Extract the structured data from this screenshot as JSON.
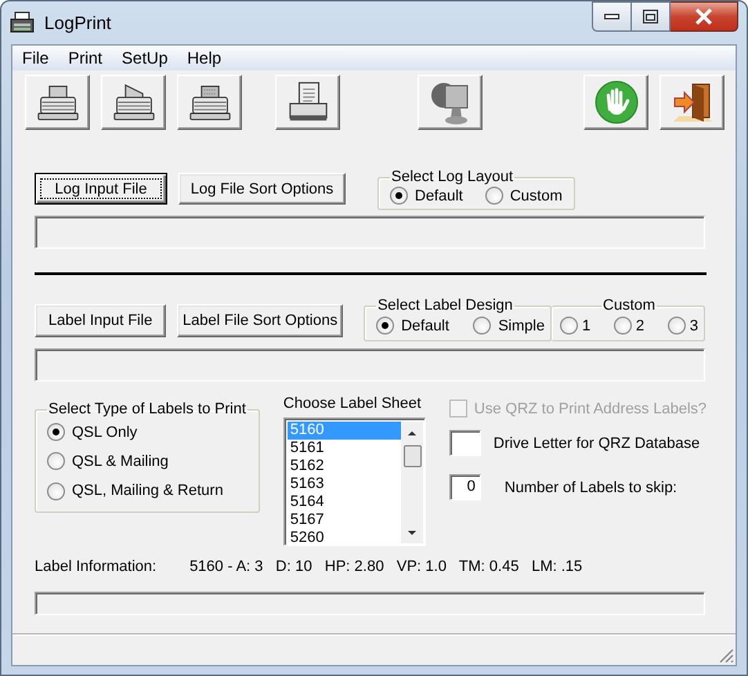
{
  "window": {
    "title": "LogPrint"
  },
  "menu": [
    "File",
    "Print",
    "SetUp",
    "Help"
  ],
  "log_section": {
    "buttons": [
      {
        "label": "Log Input File",
        "focused": true
      },
      {
        "label": "Log File Sort Options",
        "focused": false
      }
    ],
    "layout": {
      "title": "Select Log Layout",
      "options": [
        {
          "label": "Default",
          "selected": true
        },
        {
          "label": "Custom",
          "selected": false
        }
      ]
    }
  },
  "label_section": {
    "buttons": [
      {
        "label": "Label Input File",
        "focused": false
      },
      {
        "label": "Label File Sort Options",
        "focused": false
      }
    ],
    "design": {
      "title": "Select Label Design",
      "options": [
        {
          "label": "Default",
          "selected": true
        },
        {
          "label": "Simple",
          "selected": false
        }
      ]
    },
    "custom": {
      "title": "Custom",
      "options": [
        {
          "label": "1",
          "selected": false
        },
        {
          "label": "2",
          "selected": false
        },
        {
          "label": "3",
          "selected": false
        }
      ]
    }
  },
  "label_type": {
    "title": "Select Type of Labels to Print",
    "options": [
      {
        "label": "QSL Only",
        "selected": true
      },
      {
        "label": "QSL & Mailing",
        "selected": false
      },
      {
        "label": "QSL, Mailing & Return",
        "selected": false
      }
    ]
  },
  "label_sheet": {
    "title": "Choose Label Sheet",
    "items": [
      {
        "label": "5160",
        "selected": true
      },
      {
        "label": "5161",
        "selected": false
      },
      {
        "label": "5162",
        "selected": false
      },
      {
        "label": "5163",
        "selected": false
      },
      {
        "label": "5164",
        "selected": false
      },
      {
        "label": "5167",
        "selected": false
      },
      {
        "label": "5260",
        "selected": false
      }
    ]
  },
  "qrz": {
    "label": "Use QRZ to Print Address Labels?",
    "checked": false,
    "disabled": true
  },
  "drive_letter": {
    "label": "Drive Letter for QRZ Database"
  },
  "labels_to_skip": {
    "label": "Number of Labels to skip:",
    "value": "0"
  },
  "label_info": {
    "label": "Label Information:",
    "value": "5160 - A: 3   D: 10   HP: 2.80   VP: 1.0   TM: 0.45   LM: .15"
  }
}
